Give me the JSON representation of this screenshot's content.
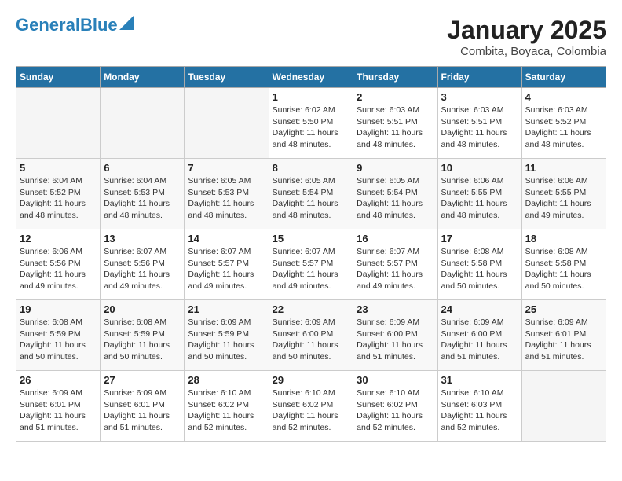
{
  "header": {
    "logo_line1": "General",
    "logo_line2": "Blue",
    "month_year": "January 2025",
    "location": "Combita, Boyaca, Colombia"
  },
  "days_of_week": [
    "Sunday",
    "Monday",
    "Tuesday",
    "Wednesday",
    "Thursday",
    "Friday",
    "Saturday"
  ],
  "weeks": [
    [
      {
        "day": "",
        "info": ""
      },
      {
        "day": "",
        "info": ""
      },
      {
        "day": "",
        "info": ""
      },
      {
        "day": "1",
        "info": "Sunrise: 6:02 AM\nSunset: 5:50 PM\nDaylight: 11 hours and 48 minutes."
      },
      {
        "day": "2",
        "info": "Sunrise: 6:03 AM\nSunset: 5:51 PM\nDaylight: 11 hours and 48 minutes."
      },
      {
        "day": "3",
        "info": "Sunrise: 6:03 AM\nSunset: 5:51 PM\nDaylight: 11 hours and 48 minutes."
      },
      {
        "day": "4",
        "info": "Sunrise: 6:03 AM\nSunset: 5:52 PM\nDaylight: 11 hours and 48 minutes."
      }
    ],
    [
      {
        "day": "5",
        "info": "Sunrise: 6:04 AM\nSunset: 5:52 PM\nDaylight: 11 hours and 48 minutes."
      },
      {
        "day": "6",
        "info": "Sunrise: 6:04 AM\nSunset: 5:53 PM\nDaylight: 11 hours and 48 minutes."
      },
      {
        "day": "7",
        "info": "Sunrise: 6:05 AM\nSunset: 5:53 PM\nDaylight: 11 hours and 48 minutes."
      },
      {
        "day": "8",
        "info": "Sunrise: 6:05 AM\nSunset: 5:54 PM\nDaylight: 11 hours and 48 minutes."
      },
      {
        "day": "9",
        "info": "Sunrise: 6:05 AM\nSunset: 5:54 PM\nDaylight: 11 hours and 48 minutes."
      },
      {
        "day": "10",
        "info": "Sunrise: 6:06 AM\nSunset: 5:55 PM\nDaylight: 11 hours and 48 minutes."
      },
      {
        "day": "11",
        "info": "Sunrise: 6:06 AM\nSunset: 5:55 PM\nDaylight: 11 hours and 49 minutes."
      }
    ],
    [
      {
        "day": "12",
        "info": "Sunrise: 6:06 AM\nSunset: 5:56 PM\nDaylight: 11 hours and 49 minutes."
      },
      {
        "day": "13",
        "info": "Sunrise: 6:07 AM\nSunset: 5:56 PM\nDaylight: 11 hours and 49 minutes."
      },
      {
        "day": "14",
        "info": "Sunrise: 6:07 AM\nSunset: 5:57 PM\nDaylight: 11 hours and 49 minutes."
      },
      {
        "day": "15",
        "info": "Sunrise: 6:07 AM\nSunset: 5:57 PM\nDaylight: 11 hours and 49 minutes."
      },
      {
        "day": "16",
        "info": "Sunrise: 6:07 AM\nSunset: 5:57 PM\nDaylight: 11 hours and 49 minutes."
      },
      {
        "day": "17",
        "info": "Sunrise: 6:08 AM\nSunset: 5:58 PM\nDaylight: 11 hours and 50 minutes."
      },
      {
        "day": "18",
        "info": "Sunrise: 6:08 AM\nSunset: 5:58 PM\nDaylight: 11 hours and 50 minutes."
      }
    ],
    [
      {
        "day": "19",
        "info": "Sunrise: 6:08 AM\nSunset: 5:59 PM\nDaylight: 11 hours and 50 minutes."
      },
      {
        "day": "20",
        "info": "Sunrise: 6:08 AM\nSunset: 5:59 PM\nDaylight: 11 hours and 50 minutes."
      },
      {
        "day": "21",
        "info": "Sunrise: 6:09 AM\nSunset: 5:59 PM\nDaylight: 11 hours and 50 minutes."
      },
      {
        "day": "22",
        "info": "Sunrise: 6:09 AM\nSunset: 6:00 PM\nDaylight: 11 hours and 50 minutes."
      },
      {
        "day": "23",
        "info": "Sunrise: 6:09 AM\nSunset: 6:00 PM\nDaylight: 11 hours and 51 minutes."
      },
      {
        "day": "24",
        "info": "Sunrise: 6:09 AM\nSunset: 6:00 PM\nDaylight: 11 hours and 51 minutes."
      },
      {
        "day": "25",
        "info": "Sunrise: 6:09 AM\nSunset: 6:01 PM\nDaylight: 11 hours and 51 minutes."
      }
    ],
    [
      {
        "day": "26",
        "info": "Sunrise: 6:09 AM\nSunset: 6:01 PM\nDaylight: 11 hours and 51 minutes."
      },
      {
        "day": "27",
        "info": "Sunrise: 6:09 AM\nSunset: 6:01 PM\nDaylight: 11 hours and 51 minutes."
      },
      {
        "day": "28",
        "info": "Sunrise: 6:10 AM\nSunset: 6:02 PM\nDaylight: 11 hours and 52 minutes."
      },
      {
        "day": "29",
        "info": "Sunrise: 6:10 AM\nSunset: 6:02 PM\nDaylight: 11 hours and 52 minutes."
      },
      {
        "day": "30",
        "info": "Sunrise: 6:10 AM\nSunset: 6:02 PM\nDaylight: 11 hours and 52 minutes."
      },
      {
        "day": "31",
        "info": "Sunrise: 6:10 AM\nSunset: 6:03 PM\nDaylight: 11 hours and 52 minutes."
      },
      {
        "day": "",
        "info": ""
      }
    ]
  ]
}
